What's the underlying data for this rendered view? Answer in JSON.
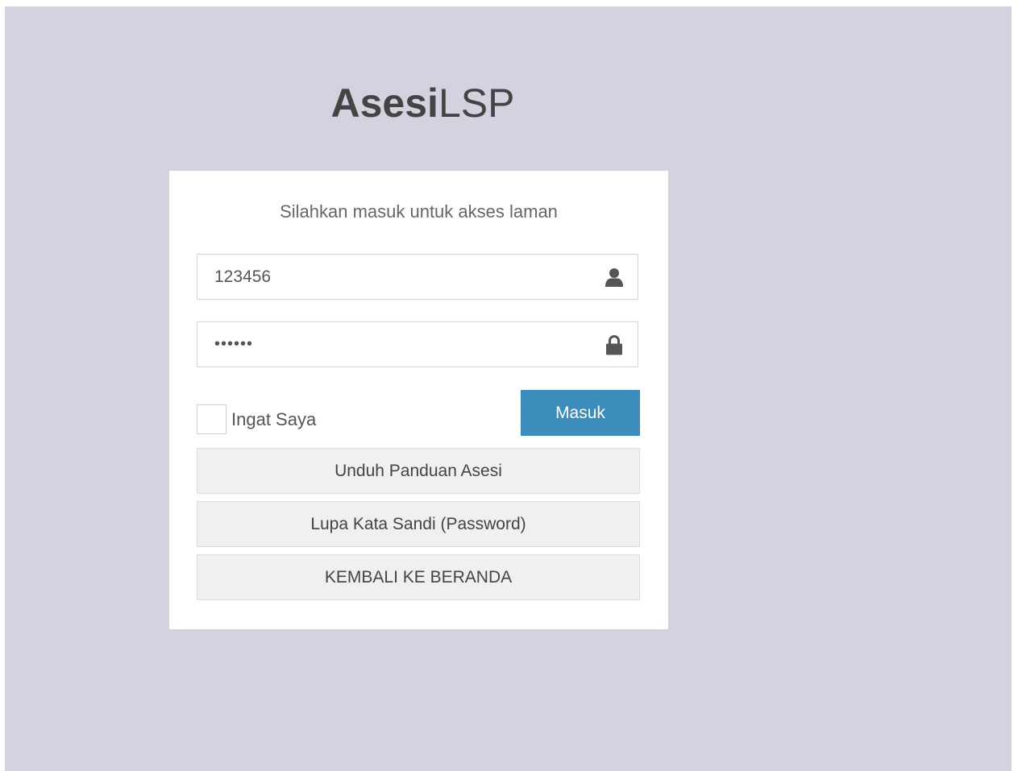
{
  "logo": {
    "bold": "Asesi",
    "light": "LSP"
  },
  "login": {
    "subtitle": "Silahkan masuk untuk akses laman",
    "username_value": "123456",
    "password_value": "••••••",
    "remember_label": "Ingat Saya",
    "submit_label": "Masuk"
  },
  "actions": {
    "download_guide": "Unduh Panduan Asesi",
    "forgot_password": "Lupa Kata Sandi (Password)",
    "back_home": "KEMBALI KE BERANDA"
  },
  "icons": {
    "username": "user-icon",
    "password": "lock-icon"
  },
  "colors": {
    "background": "#d2d3de",
    "card": "#ffffff",
    "primary": "#3c8dbc",
    "secondary_button": "#f0f0f0"
  }
}
